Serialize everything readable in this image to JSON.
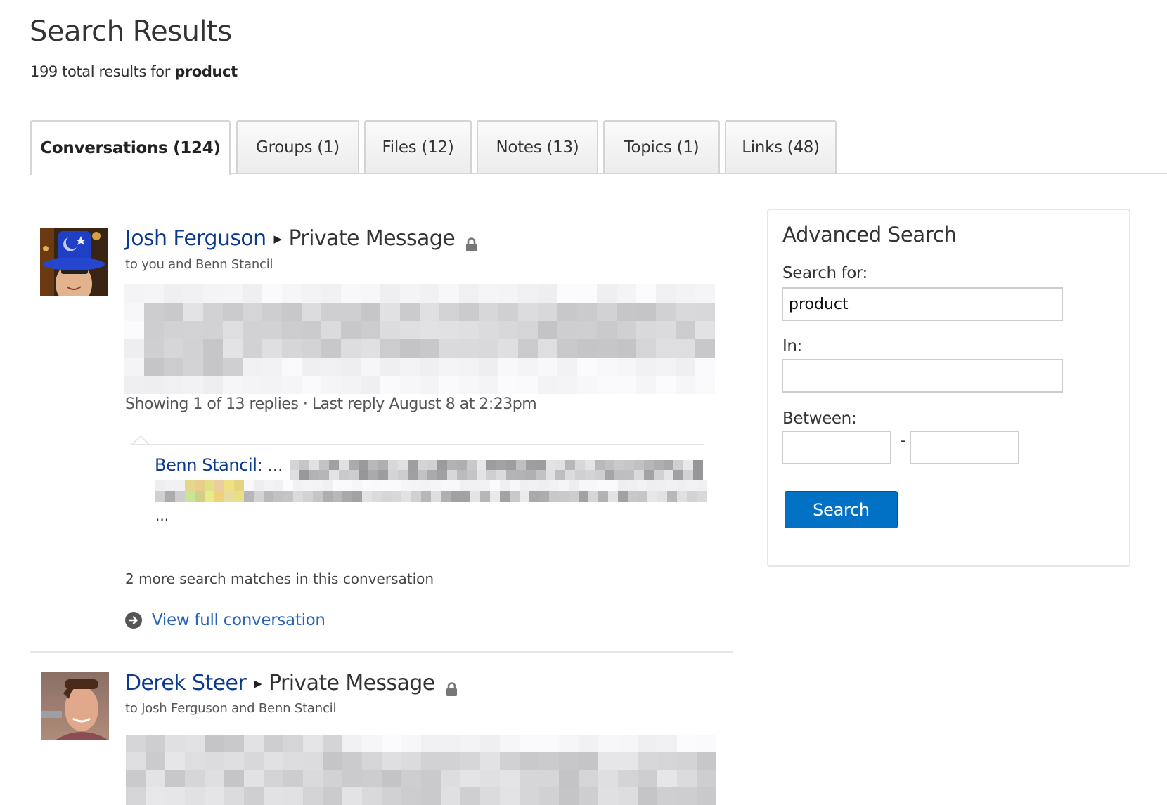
{
  "header": {
    "title": "Search Results",
    "summary_prefix": "199 total results for",
    "query": "product"
  },
  "tabs": [
    {
      "label": "Conversations (124)",
      "active": true
    },
    {
      "label": "Groups (1)",
      "active": false
    },
    {
      "label": "Files (12)",
      "active": false
    },
    {
      "label": "Notes (13)",
      "active": false
    },
    {
      "label": "Topics (1)",
      "active": false
    },
    {
      "label": "Links (48)",
      "active": false
    }
  ],
  "results": [
    {
      "author": "Josh Ferguson",
      "type": "Private Message",
      "recipients": "to you and Benn Stancil",
      "body": "[blurred message text]",
      "reply_summary": "Showing 1 of 13 replies · Last reply August 8 at 2:23pm",
      "reply": {
        "author": "Benn Stancil:",
        "leading_ellipsis": "...",
        "snippet": "[blurred reply text]",
        "trailing_ellipsis": "..."
      },
      "more_matches": "2 more search matches in this conversation",
      "view_full": "View full conversation"
    },
    {
      "author": "Derek Steer",
      "type": "Private Message",
      "recipients": "to Josh Ferguson and Benn Stancil",
      "body": "[blurred message text]"
    }
  ],
  "icons": {
    "separator": "triangle-right-icon",
    "privacy": "lock-icon",
    "view_full": "arrow-right-circle-icon"
  },
  "advanced_search": {
    "title": "Advanced Search",
    "search_for_label": "Search for:",
    "search_for_value": "product",
    "in_label": "In:",
    "in_value": "",
    "between_label": "Between:",
    "between_start": "",
    "between_end": "",
    "between_separator": "-",
    "submit_label": "Search"
  },
  "colors": {
    "link": "#0a3a8f",
    "action_link": "#2a64b8",
    "button": "#0071c5",
    "highlight": "#f6f3a6"
  }
}
